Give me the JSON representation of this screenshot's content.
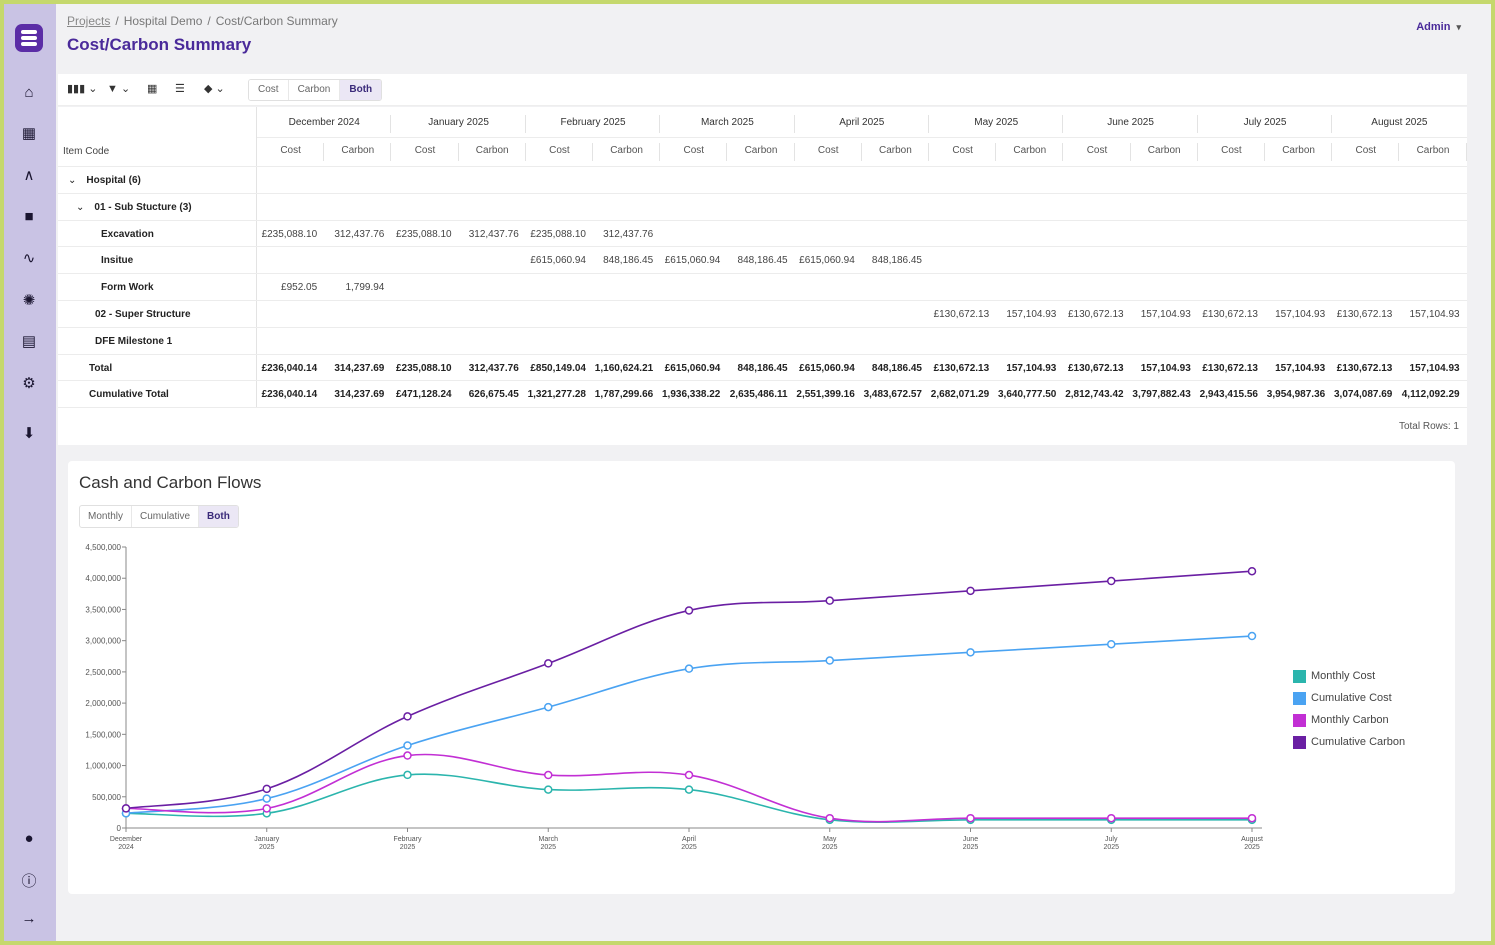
{
  "breadcrumb": {
    "projects": "Projects",
    "demo": "Hospital Demo",
    "current": "Cost/Carbon Summary",
    "separator": "/"
  },
  "page_title": "Cost/Carbon Summary",
  "user_menu": {
    "label": "Admin",
    "caret": "▾"
  },
  "toolbar": {
    "toggle_options": [
      "Cost",
      "Carbon",
      "Both"
    ],
    "toggle_selected": "Both"
  },
  "grid": {
    "item_code_header": "Item Code",
    "months": [
      "December 2024",
      "January 2025",
      "February 2025",
      "March 2025",
      "April 2025",
      "May 2025",
      "June 2025",
      "July 2025",
      "August 2025"
    ],
    "sub_headers": [
      "Cost",
      "Carbon"
    ],
    "rows": [
      {
        "label": "Hospital (6)",
        "caret": "⌄",
        "bold": true,
        "values": []
      },
      {
        "label": "01 - Sub Stucture (3)",
        "caret": "⌄",
        "bold": true,
        "values": []
      },
      {
        "label": "Excavation",
        "bold": true,
        "values": [
          "£235,088.10",
          "312,437.76",
          "£235,088.10",
          "312,437.76",
          "£235,088.10",
          "312,437.76",
          "",
          "",
          "",
          "",
          "",
          "",
          "",
          "",
          "",
          "",
          "",
          ""
        ]
      },
      {
        "label": "Insitue",
        "bold": true,
        "values": [
          "",
          "",
          "",
          "",
          "£615,060.94",
          "848,186.45",
          "£615,060.94",
          "848,186.45",
          "£615,060.94",
          "848,186.45",
          "",
          "",
          "",
          "",
          "",
          "",
          "",
          ""
        ]
      },
      {
        "label": "Form Work",
        "bold": true,
        "values": [
          "£952.05",
          "1,799.94",
          "",
          "",
          "",
          "",
          "",
          "",
          "",
          "",
          "",
          "",
          "",
          "",
          "",
          "",
          "",
          ""
        ]
      },
      {
        "label": "02 - Super Structure",
        "bold": true,
        "values": [
          "",
          "",
          "",
          "",
          "",
          "",
          "",
          "",
          "",
          "",
          "£130,672.13",
          "157,104.93",
          "£130,672.13",
          "157,104.93",
          "£130,672.13",
          "157,104.93",
          "£130,672.13",
          "157,104.93"
        ]
      },
      {
        "label": "DFE Milestone 1",
        "bold": true,
        "values": []
      },
      {
        "label": "Total",
        "bold": true,
        "totals": true,
        "values": [
          "£236,040.14",
          "314,237.69",
          "£235,088.10",
          "312,437.76",
          "£850,149.04",
          "1,160,624.21",
          "£615,060.94",
          "848,186.45",
          "£615,060.94",
          "848,186.45",
          "£130,672.13",
          "157,104.93",
          "£130,672.13",
          "157,104.93",
          "£130,672.13",
          "157,104.93",
          "£130,672.13",
          "157,104.93"
        ]
      },
      {
        "label": "Cumulative Total",
        "bold": true,
        "totals": true,
        "values": [
          "£236,040.14",
          "314,237.69",
          "£471,128.24",
          "626,675.45",
          "1,321,277.28",
          "1,787,299.66",
          "1,936,338.22",
          "2,635,486.11",
          "2,551,399.16",
          "3,483,672.57",
          "2,682,071.29",
          "3,640,777.50",
          "2,812,743.42",
          "3,797,882.43",
          "2,943,415.56",
          "3,954,987.36",
          "3,074,087.69",
          "4,112,092.29"
        ]
      }
    ],
    "total_rows": "Total Rows: 1"
  },
  "chart_panel": {
    "title": "Cash and Carbon Flows",
    "view_options": [
      "Monthly",
      "Cumulative",
      "Both"
    ],
    "view_selected": "Both"
  },
  "chart_data": {
    "type": "line",
    "x": [
      "December 2024",
      "January 2025",
      "February 2025",
      "March 2025",
      "April 2025",
      "May 2025",
      "June 2025",
      "July 2025",
      "August 2025"
    ],
    "ylim": [
      0,
      4500000
    ],
    "y_ticks": [
      "0",
      "500,000",
      "1,000,000",
      "1,500,000",
      "2,000,000",
      "2,500,000",
      "3,000,000",
      "3,500,000",
      "4,000,000",
      "4,500,000"
    ],
    "legend_position": "right",
    "series": [
      {
        "name": "Monthly Cost",
        "color": "#2bb5ad",
        "values": [
          236040.14,
          235088.1,
          850149.04,
          615060.94,
          615060.94,
          130672.13,
          130672.13,
          130672.13,
          130672.13
        ]
      },
      {
        "name": "Cumulative Cost",
        "color": "#4aa3f2",
        "values": [
          236040.14,
          471128.24,
          1321277.28,
          1936338.22,
          2551399.16,
          2682071.29,
          2812743.42,
          2943415.56,
          3074087.69
        ]
      },
      {
        "name": "Monthly Carbon",
        "color": "#c22fd4",
        "values": [
          314237.69,
          312437.76,
          1160624.21,
          848186.45,
          848186.45,
          157104.93,
          157104.93,
          157104.93,
          157104.93
        ]
      },
      {
        "name": "Cumulative Carbon",
        "color": "#6a1fa3",
        "values": [
          314237.69,
          626675.45,
          1787299.66,
          2635486.11,
          3483672.57,
          3640777.5,
          3797882.43,
          3954987.36,
          4112092.29
        ]
      }
    ]
  }
}
